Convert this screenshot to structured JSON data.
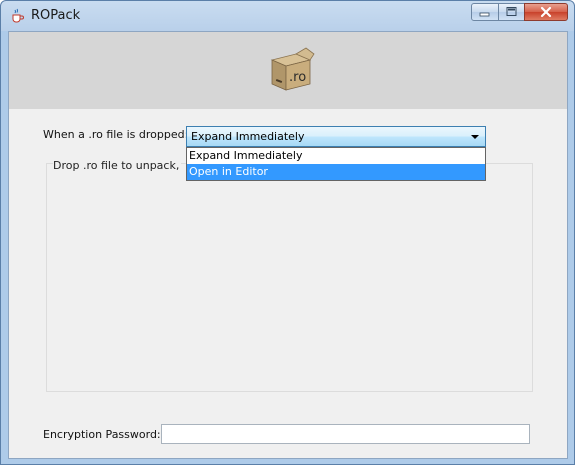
{
  "window": {
    "title": "ROPack",
    "icon": "java-cup-icon",
    "controls": [
      "minimize-icon",
      "maximize-icon",
      "close-icon"
    ]
  },
  "banner": {
    "logo_icon": "package-box-icon",
    "logo_text": ".ro"
  },
  "form": {
    "drop_action_label": "When a .ro file is dropped:",
    "drop_action_value": "Expand Immediately",
    "drop_action_options": [
      "Expand Immediately",
      "Open in Editor"
    ],
    "drop_action_highlighted_index": 1,
    "drop_area_text": "Drop .ro file to unpack, or fo",
    "password_label": "Encryption Password:",
    "password_value": ""
  },
  "colors": {
    "selection": "#3399ff",
    "window_frame": "#aecbe9",
    "banner": "#d6d6d6",
    "panel": "#f0f0f0"
  }
}
